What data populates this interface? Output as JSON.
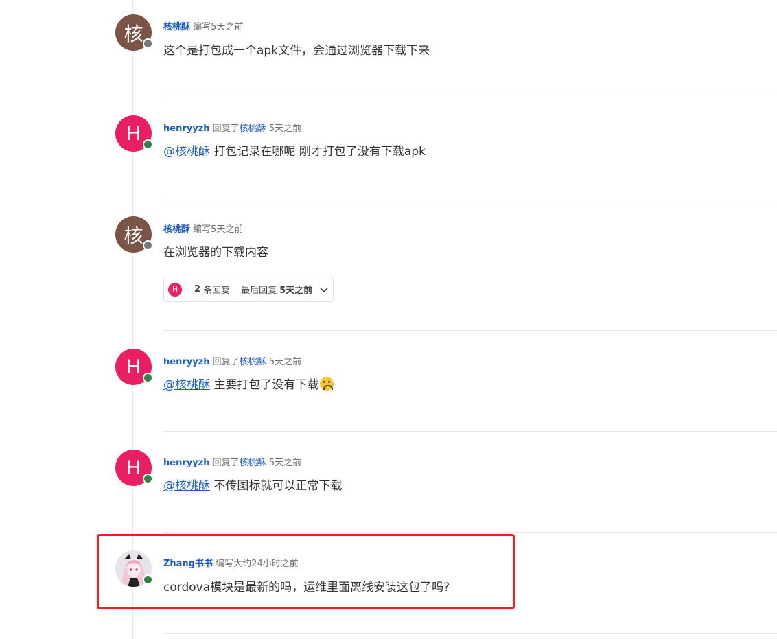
{
  "posts": [
    {
      "avatar_letter": "核",
      "avatar_color": "#7a5447",
      "status": "offline",
      "username": "核桃酥",
      "action": "编写",
      "time": "5天之前",
      "body": "这个是打包成一个apk文件，会通过浏览器下载下来"
    },
    {
      "avatar_letter": "H",
      "avatar_color": "#e91e63",
      "status": "online",
      "username": "henryyzh",
      "action": "回复了",
      "reply_to": "核桃酥",
      "time": "5天之前",
      "mention": "@核桃酥",
      "body": "打包记录在哪呢 刚才打包了没有下载apk"
    },
    {
      "avatar_letter": "核",
      "avatar_color": "#7a5447",
      "status": "offline",
      "username": "核桃酥",
      "action": "编写",
      "time": "5天之前",
      "body": "在浏览器的下载内容",
      "replies": {
        "avatar_letter": "H",
        "count": "2",
        "label": "条回复",
        "last_label": "最后回复",
        "last_time": "5天之前"
      }
    },
    {
      "avatar_letter": "H",
      "avatar_color": "#e91e63",
      "status": "online",
      "username": "henryyzh",
      "action": "回复了",
      "reply_to": "核桃酥",
      "time": "5天之前",
      "mention": "@核桃酥",
      "body": "主要打包了没有下载",
      "emoji": "confused-face"
    },
    {
      "avatar_letter": "H",
      "avatar_color": "#e91e63",
      "status": "online",
      "username": "henryyzh",
      "action": "回复了",
      "reply_to": "核桃酥",
      "time": "5天之前",
      "mention": "@核桃酥",
      "body": "不传图标就可以正常下载"
    },
    {
      "avatar_image": "anime-girl-avatar",
      "status": "online",
      "username": "Zhang书书",
      "action": "编写",
      "time": "大约24小时之前",
      "body": "cordova模块是最新的吗，运维里面离线安装这包了吗?",
      "highlighted": true,
      "highlight_color": "#f02020"
    }
  ],
  "colors": {
    "link": "#1e5cc0",
    "online": "#2e8540",
    "offline": "#777777"
  }
}
